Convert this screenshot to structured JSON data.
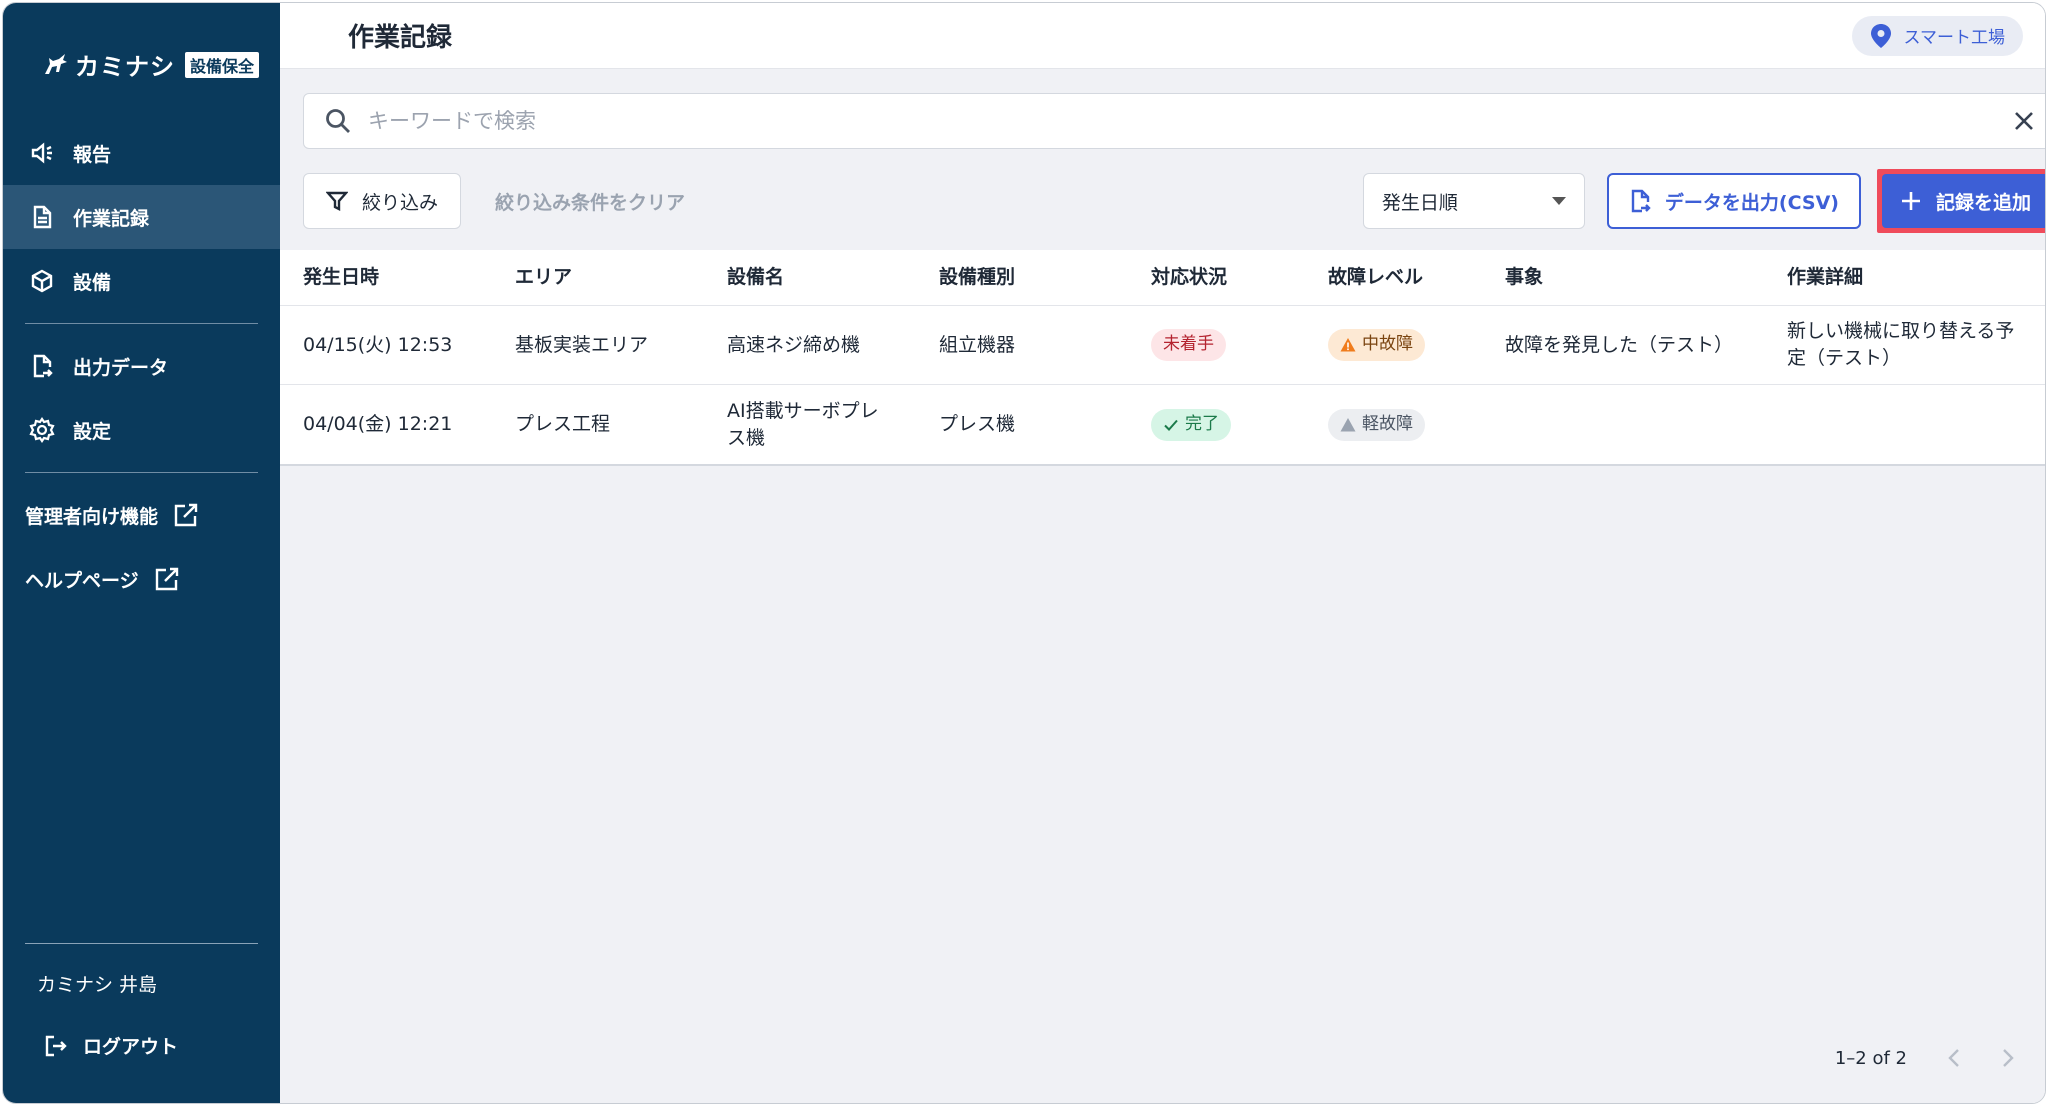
{
  "sidebar": {
    "logo_text": "カミナシ",
    "logo_badge": "設備保全",
    "items": [
      {
        "label": "報告"
      },
      {
        "label": "作業記録"
      },
      {
        "label": "設備"
      },
      {
        "label": "出力データ"
      },
      {
        "label": "設定"
      }
    ],
    "links": [
      {
        "label": "管理者向け機能"
      },
      {
        "label": "ヘルプページ"
      }
    ],
    "user_name": "カミナシ 井島",
    "logout_label": "ログアウト"
  },
  "header": {
    "title": "作業記録",
    "location": "スマート工場"
  },
  "search": {
    "placeholder": "キーワードで検索"
  },
  "toolbar": {
    "filter_label": "絞り込み",
    "clear_filter_label": "絞り込み条件をクリア",
    "sort_value": "発生日順",
    "csv_label": "データを出力(CSV)",
    "add_label": "記録を追加"
  },
  "table": {
    "columns": [
      "発生日時",
      "エリア",
      "設備名",
      "設備種別",
      "対応状況",
      "故障レベル",
      "事象",
      "作業詳細"
    ],
    "rows": [
      {
        "datetime": "04/15(火) 12:53",
        "area": "基板実装エリア",
        "equipment": "高速ネジ締め機",
        "type": "組立機器",
        "status": "未着手",
        "level": "中故障",
        "event": "故障を発見した（テスト）",
        "detail": "新しい機械に取り替える予定（テスト）"
      },
      {
        "datetime": "04/04(金) 12:21",
        "area": "プレス工程",
        "equipment": "AI搭載サーボプレス機",
        "type": "プレス機",
        "status": "完了",
        "level": "軽故障",
        "event": "",
        "detail": ""
      }
    ]
  },
  "pagination": {
    "range": "1–2 of 2"
  },
  "colors": {
    "sidebar": "#0a3a5c",
    "accent": "#3d5fd6",
    "highlight_border": "#ef4b5b"
  }
}
